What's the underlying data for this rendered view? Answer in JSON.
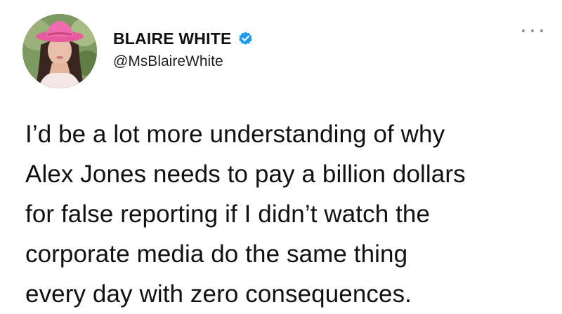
{
  "tweet": {
    "author": {
      "display_name": "BLAIRE WHITE",
      "handle": "@MsBlaireWhite",
      "verified": true,
      "verified_color": "#1d9bf0",
      "avatar_icon": "profile-photo-avatar"
    },
    "more_icon": "more-horizontal-icon",
    "text_lines": [
      "I’d be a lot more understanding of why",
      "Alex Jones needs to pay a billion dollars",
      "for false reporting if I didn’t watch the",
      "corporate media do the same thing",
      "every day with zero consequences."
    ]
  }
}
